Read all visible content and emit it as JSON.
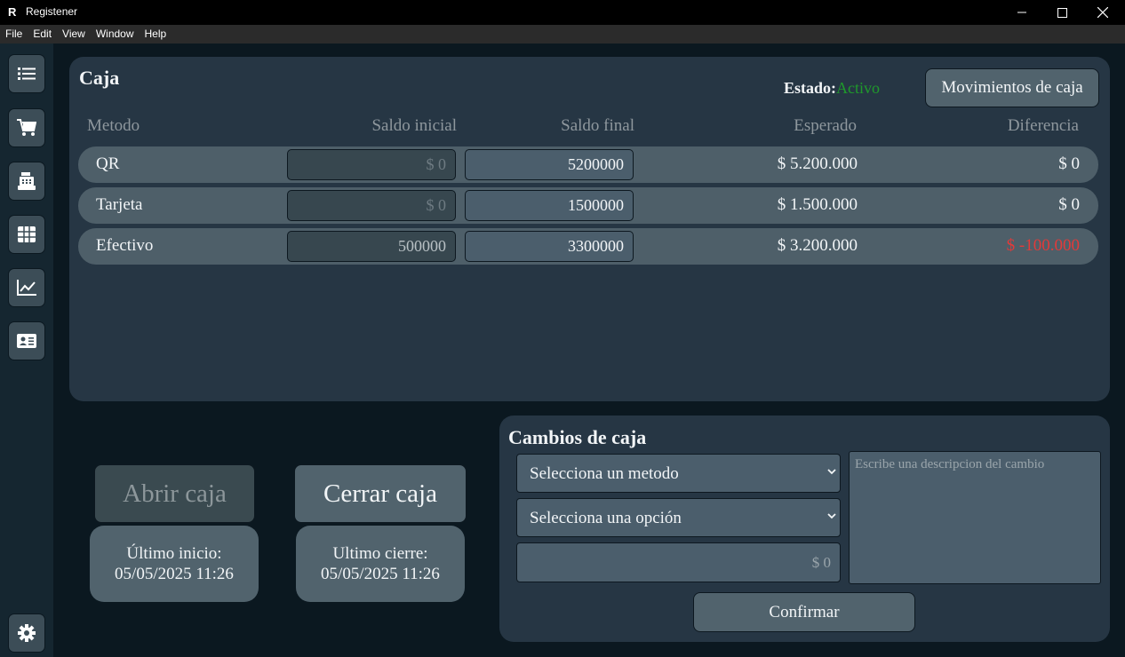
{
  "window": {
    "title": "Registener",
    "logo": "R"
  },
  "menu": [
    "File",
    "Edit",
    "View",
    "Window",
    "Help"
  ],
  "sidebar": {
    "items": [
      {
        "icon": "list-icon"
      },
      {
        "icon": "cart-icon"
      },
      {
        "icon": "cash-register-icon"
      },
      {
        "icon": "grid-icon"
      },
      {
        "icon": "chart-icon"
      },
      {
        "icon": "id-card-icon"
      }
    ],
    "settings_icon": "gear-icon"
  },
  "caja": {
    "title": "Caja",
    "estado_label": "Estado:",
    "estado_value": "Activo",
    "estado_color": "#1f9a2b",
    "movimientos_button": "Movimientos de caja",
    "headers": {
      "metodo": "Metodo",
      "saldo_inicial": "Saldo inicial",
      "saldo_final": "Saldo final",
      "esperado": "Esperado",
      "diferencia": "Diferencia"
    },
    "rows": [
      {
        "metodo": "QR",
        "saldo_inicial": "",
        "saldo_inicial_placeholder": "$ 0",
        "saldo_final": "5200000",
        "esperado": "$ 5.200.000",
        "diferencia": "$ 0"
      },
      {
        "metodo": "Tarjeta",
        "saldo_inicial": "",
        "saldo_inicial_placeholder": "$ 0",
        "saldo_final": "1500000",
        "esperado": "$ 1.500.000",
        "diferencia": "$ 0"
      },
      {
        "metodo": "Efectivo",
        "saldo_inicial": "500000",
        "saldo_final": "3300000",
        "esperado": "$ 3.200.000",
        "diferencia": "$ -100.000"
      }
    ],
    "negative_color": "#e23a3a"
  },
  "actions": {
    "abrir_label": "Abrir caja",
    "cerrar_label": "Cerrar caja",
    "ultimo_inicio_label": "Último inicio:",
    "ultimo_inicio_value": "05/05/2025 11:26",
    "ultimo_cierre_label": "Ultimo cierre:",
    "ultimo_cierre_value": "05/05/2025 11:26"
  },
  "cambios": {
    "title": "Cambios de caja",
    "metodo_select": "Selecciona un metodo",
    "opcion_select": "Selecciona una opción",
    "amount_placeholder": "$ 0",
    "description_placeholder": "Escribe una descripcion del cambio",
    "confirm_label": "Confirmar"
  }
}
